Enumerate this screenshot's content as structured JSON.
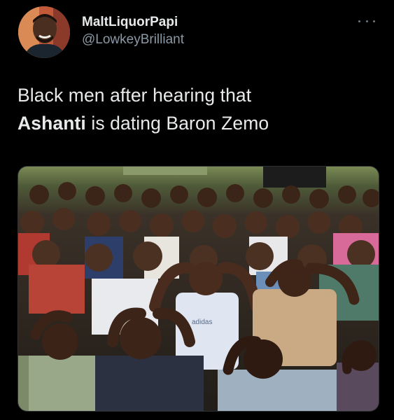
{
  "tweet": {
    "display_name": "MaltLiquorPapi",
    "handle": "@LowkeyBrilliant",
    "text_line1": "Black men after hearing that",
    "text_bold": "Ashanti",
    "text_line2_rest": " is dating Baron Zemo",
    "more_icon": "ellipsis-icon"
  },
  "media": {
    "shirt_print": "adidas"
  },
  "colors": {
    "background": "#000000",
    "text_primary": "#e7e9ea",
    "text_secondary": "#8b98a5"
  }
}
